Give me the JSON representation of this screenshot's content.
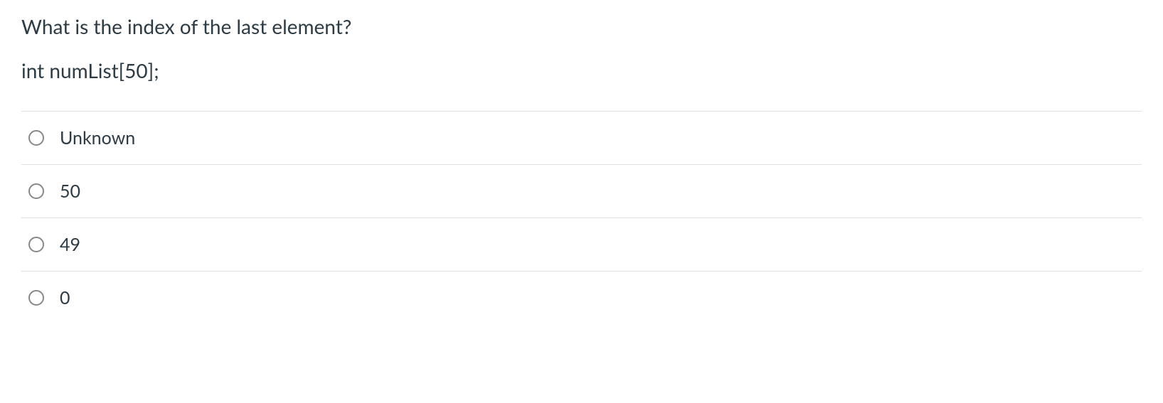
{
  "question": {
    "prompt": "What is the index of the last element?",
    "code": "int numList[50];"
  },
  "options": [
    {
      "label": "Unknown"
    },
    {
      "label": "50"
    },
    {
      "label": "49"
    },
    {
      "label": "0"
    }
  ]
}
